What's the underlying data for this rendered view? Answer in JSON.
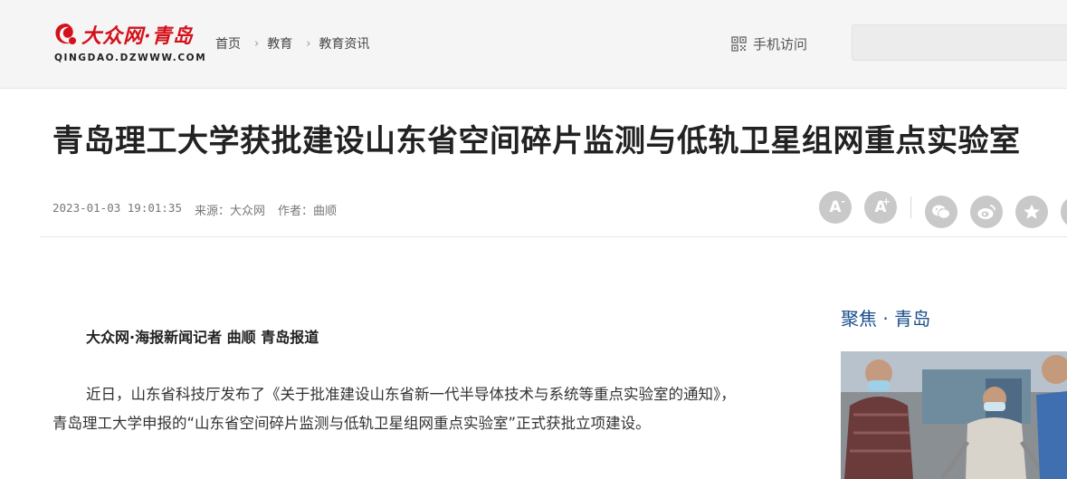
{
  "header": {
    "logo_text": "大众网·青岛",
    "logo_sub": "QINGDAO.DZWWW.COM",
    "breadcrumb": [
      "首页",
      "教育",
      "教育资讯"
    ],
    "mobile_label": "手机访问",
    "search_placeholder": ""
  },
  "article": {
    "title": "青岛理工大学获批建设山东省空间碎片监测与低轨卫星组网重点实验室",
    "timestamp": "2023-01-03 19:01:35",
    "source": "来源：大众网",
    "author": "作者：曲顺",
    "byline": "大众网·海报新闻记者 曲顺 青岛报道",
    "paragraph": "近日，山东省科技厅发布了《关于批准建设山东省新一代半导体技术与系统等重点实验室的通知》，青岛理工大学申报的“山东省空间碎片监测与低轨卫星组网重点实验室”正式获批立项建设。"
  },
  "tools": {
    "font_decrease": "A",
    "font_increase": "A",
    "minus": "-",
    "plus": "+"
  },
  "sidebar": {
    "title": "聚焦 · 青岛"
  },
  "colors": {
    "brand_red": "#d4111a",
    "sidebar_blue": "#1a4d8c",
    "icon_gray": "#c9c9c9"
  }
}
